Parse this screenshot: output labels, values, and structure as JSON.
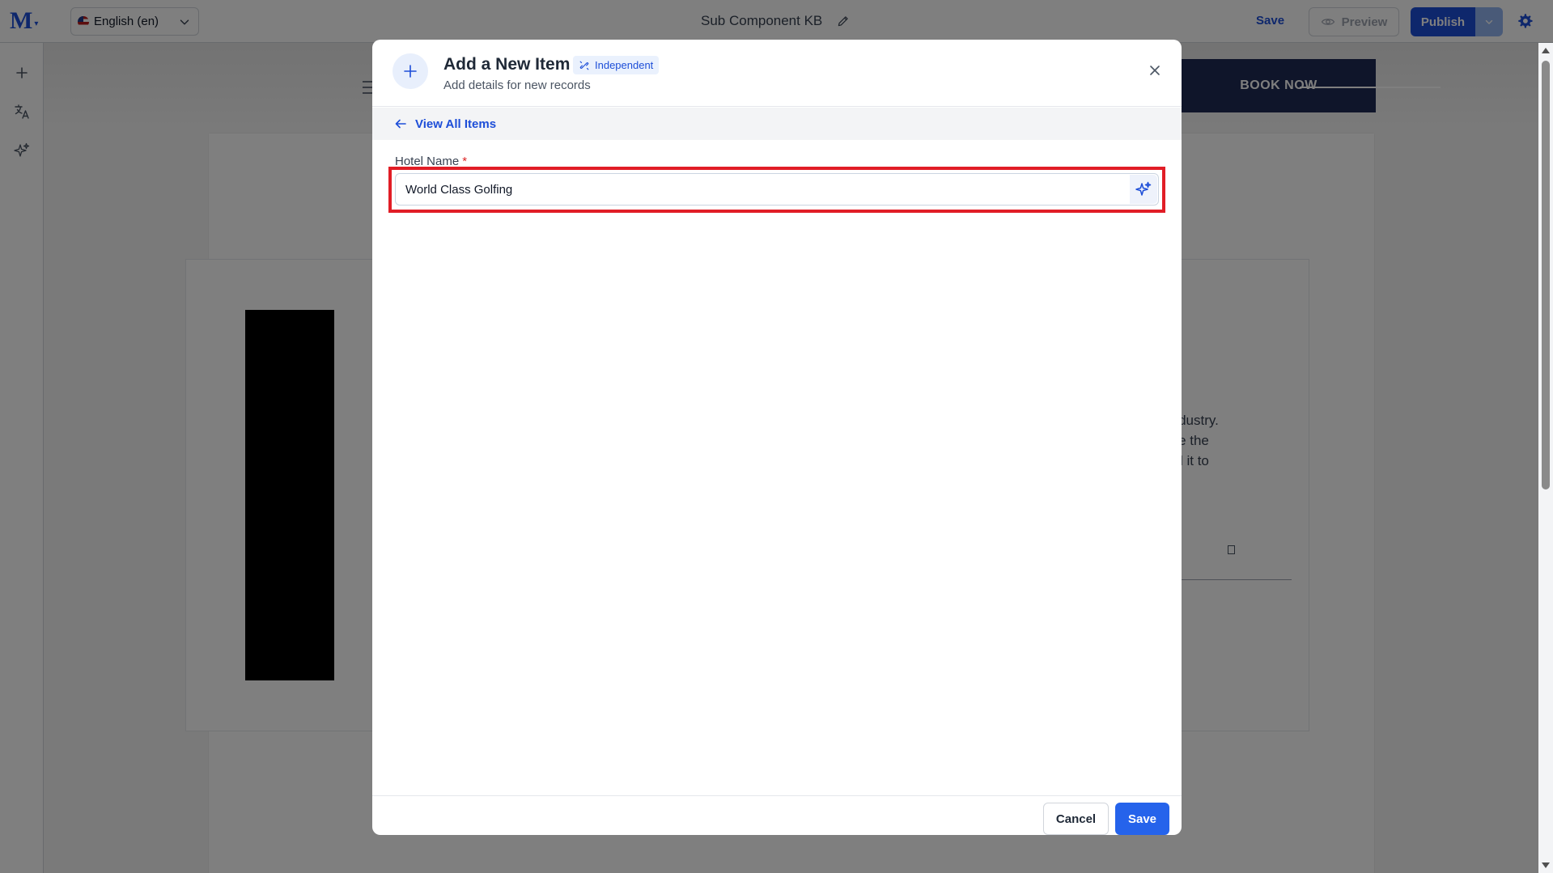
{
  "app": {
    "logo_letter": "M",
    "language": "English (en)",
    "document_title": "Sub Component KB",
    "save_label": "Save",
    "preview_label": "Preview",
    "publish_label": "Publish"
  },
  "colors": {
    "accent": "#1d4ed8",
    "primary_button": "#2563eb",
    "highlight_border": "#e11d26",
    "required_marker": "#dc2626"
  },
  "left_rail": {
    "icons": [
      "plus-icon",
      "translate-icon",
      "sparkle-icon"
    ]
  },
  "background_page": {
    "book_now_label": "BOOK NOW",
    "text_lines": [
      "tting industry.",
      "er since the",
      "ambled it to"
    ]
  },
  "modal": {
    "title": "Add a New Item",
    "badge": "Independent",
    "subtitle": "Add details for new records",
    "back_link": "View All Items",
    "field": {
      "label": "Hotel Name",
      "required_marker": "*",
      "value": "World Class Golfing"
    },
    "cancel_label": "Cancel",
    "save_label": "Save"
  }
}
